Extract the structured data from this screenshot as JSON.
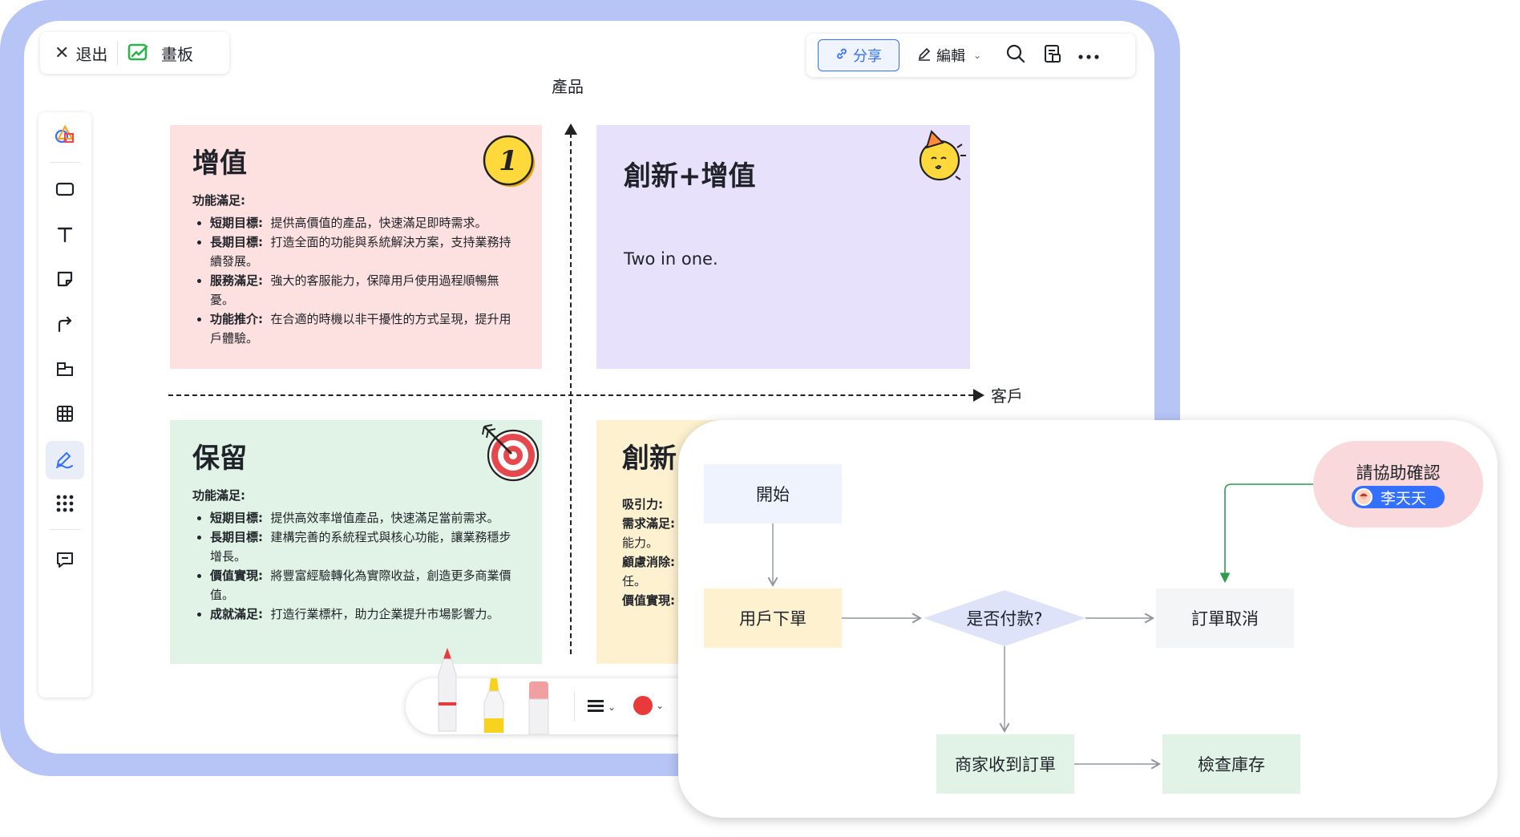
{
  "header": {
    "exit_label": "退出",
    "board_label": "畫板",
    "share_label": "分享",
    "edit_label": "編輯"
  },
  "axes": {
    "y_label": "產品",
    "x_label": "客戶"
  },
  "quadrants": {
    "top_left": {
      "title": "增值",
      "subtitle": "功能滿足:",
      "items": [
        {
          "key": "短期目標:",
          "text": "提供高價值的產品，快速滿足即時需求。"
        },
        {
          "key": "長期目標:",
          "text": "打造全面的功能與系統解決方案，支持業務持續發展。"
        },
        {
          "key": "服務滿足:",
          "text": "強大的客服能力，保障用戶使用過程順暢無憂。"
        },
        {
          "key": "功能推介:",
          "text": "在合適的時機以非干擾性的方式呈現，提升用戶體驗。"
        }
      ],
      "badge": "1"
    },
    "top_right": {
      "title": "創新+增值",
      "body": "Two in one."
    },
    "bottom_left": {
      "title": "保留",
      "subtitle": "功能滿足:",
      "items": [
        {
          "key": "短期目標:",
          "text": "提供高效率增值產品，快速滿足當前需求。"
        },
        {
          "key": "長期目標:",
          "text": "建構完善的系統程式與核心功能，讓業務穩步增長。"
        },
        {
          "key": "價值實現:",
          "text": "將豐富經驗轉化為實際收益，創造更多商業價值。"
        },
        {
          "key": "成就滿足:",
          "text": "打造行業標杆，助力企業提升市場影響力。"
        }
      ]
    },
    "bottom_right": {
      "title": "創新",
      "lines": [
        "吸引力:",
        "需求滿足:",
        "能力。",
        "顧慮消除:",
        "任。",
        "價值實現:"
      ]
    }
  },
  "flowchart": {
    "start": "開始",
    "order": "用戶下單",
    "decision": "是否付款?",
    "cancel": "訂單取消",
    "received": "商家收到訂單",
    "stock": "檢查庫存",
    "comment": "請協助確認",
    "mention": "李天天"
  },
  "colors": {
    "frame": "#b7c4f6",
    "accent": "#3370ff",
    "pink_card": "#fde0e0",
    "purple_card": "#e7e1fb",
    "green_card": "#e1f3e6",
    "yellow_card": "#fdf1cf",
    "pen_color": "#e83a3a"
  },
  "icons": [
    "close-icon",
    "board-icon",
    "link-icon",
    "pen-icon",
    "chevron-down-icon",
    "search-icon",
    "notes-icon",
    "more-icon",
    "shapes-icon",
    "rectangle-icon",
    "text-icon",
    "sticky-note-icon",
    "connector-icon",
    "frame-icon",
    "table-icon",
    "draw-icon",
    "apps-icon",
    "comment-icon",
    "target-icon",
    "party-emoji-icon",
    "medal-icon"
  ]
}
